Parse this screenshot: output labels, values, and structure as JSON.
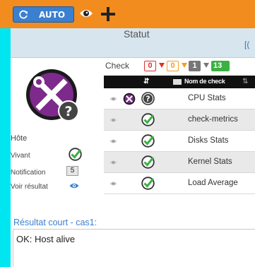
{
  "toolbar": {
    "auto_label": "AUTO",
    "refresh_icon": "refresh-icon",
    "eye_icon": "eye-icon",
    "plus_icon": "plus-icon"
  },
  "statut": {
    "title": "Statut",
    "right_fragment": "[("
  },
  "host": {
    "label": "Hôte",
    "vivant_label": "Vivant",
    "notification_label": "Notification",
    "notification_value": "5",
    "voir_label": "Voir résultat"
  },
  "check": {
    "label": "Check",
    "counts": [
      "0",
      "0",
      "1",
      "13"
    ],
    "count_colors": [
      "#e03030",
      "#f2a020",
      "#777777",
      "#3cb043"
    ],
    "col_name": "Nom de check",
    "rows": [
      {
        "name": "CPU Stats",
        "status": "unknown"
      },
      {
        "name": "check-metrics",
        "status": "ok"
      },
      {
        "name": "Disks Stats",
        "status": "ok"
      },
      {
        "name": "Kernel Stats",
        "status": "ok"
      },
      {
        "name": "Load Average",
        "status": "ok"
      }
    ]
  },
  "court": {
    "title": "Résultat court - cas1:",
    "text": "OK: Host alive"
  },
  "colors": {
    "toolbar": "#f28c1e",
    "accent": "#3a7fd0",
    "ok": "#3cb043",
    "background": "#00e6f0"
  }
}
